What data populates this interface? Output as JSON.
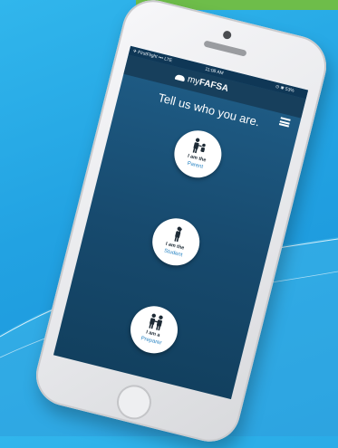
{
  "colors": {
    "background": "#22a2e2",
    "accent_bar": "#6ebd4a",
    "screen": "#1a4f75",
    "link_blue": "#2c86c4"
  },
  "status_bar": {
    "carrier": "✈ FirstFlight ••• LTE",
    "time": "11:08 AM",
    "battery": "⊙ ✱ 53%"
  },
  "app": {
    "logo_prefix": "my",
    "logo_main": "FAFSA"
  },
  "headline": "Tell us who you are.",
  "options": [
    {
      "icon": "parent-child-icon",
      "line1": "I am the",
      "line2": "Parent"
    },
    {
      "icon": "student-icon",
      "line1": "I am the",
      "line2": "Student"
    },
    {
      "icon": "preparer-icon",
      "line1": "I am a",
      "line2": "Preparer"
    }
  ]
}
